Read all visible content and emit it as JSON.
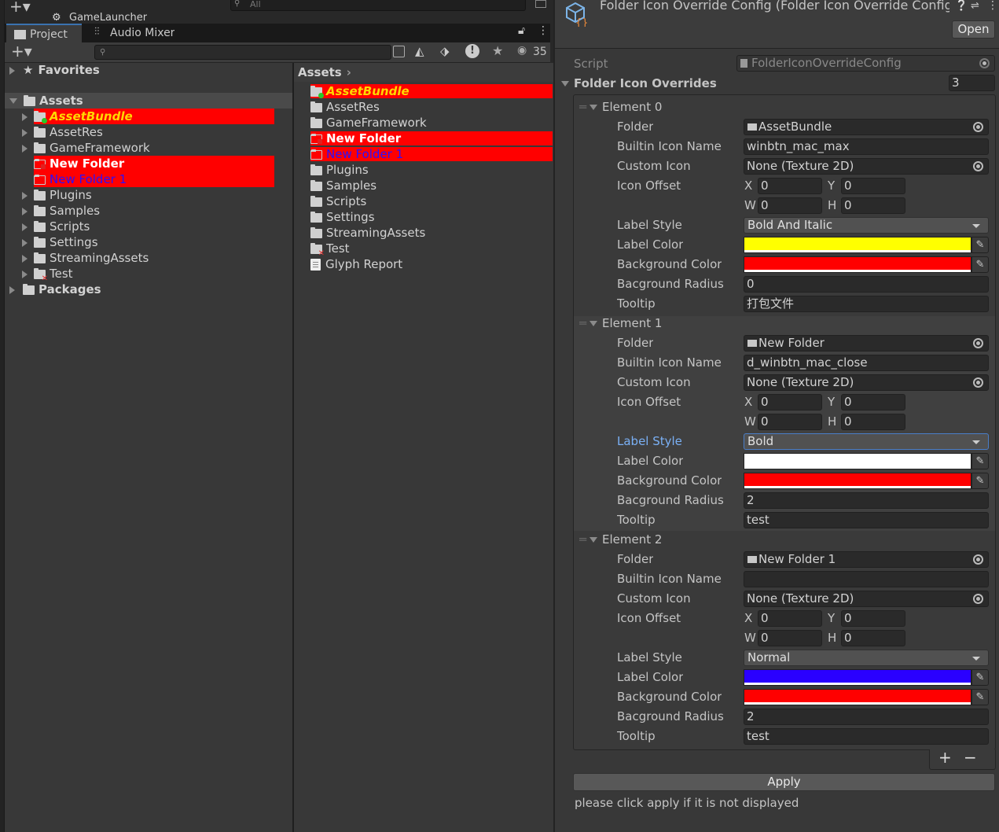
{
  "top": {
    "search_placeholder": "All",
    "launcher": "GameLauncher"
  },
  "tabs": {
    "project": "Project",
    "audio_mixer": "Audio Mixer"
  },
  "project_toolbar": {
    "search_value": "",
    "hidden_count": "35"
  },
  "tree": {
    "favorites": "Favorites",
    "assets": "Assets",
    "items": [
      {
        "label": "AssetBundle",
        "style": "yellow-italic-red"
      },
      {
        "label": "AssetRes",
        "style": "normal"
      },
      {
        "label": "GameFramework",
        "style": "normal"
      },
      {
        "label": "New Folder",
        "style": "white-bold-red"
      },
      {
        "label": "New Folder 1",
        "style": "blue-red"
      },
      {
        "label": "Plugins",
        "style": "normal"
      },
      {
        "label": "Samples",
        "style": "normal"
      },
      {
        "label": "Scripts",
        "style": "normal"
      },
      {
        "label": "Settings",
        "style": "normal"
      },
      {
        "label": "StreamingAssets",
        "style": "normal"
      },
      {
        "label": "Test",
        "style": "normal"
      }
    ],
    "packages": "Packages"
  },
  "grid": {
    "breadcrumb": "Assets",
    "items": [
      "AssetBundle",
      "AssetRes",
      "GameFramework",
      "New Folder",
      "New Folder 1",
      "Plugins",
      "Samples",
      "Scripts",
      "Settings",
      "StreamingAssets",
      "Test",
      "Glyph Report"
    ]
  },
  "inspector": {
    "title": "Folder Icon Override Config (Folder Icon Override Config",
    "open_button": "Open",
    "script_label": "Script",
    "script_value": "FolderIconOverrideConfig",
    "list_label": "Folder Icon Overrides",
    "list_size": "3",
    "labels": {
      "folder": "Folder",
      "builtin": "Builtin Icon Name",
      "custom": "Custom Icon",
      "offset": "Icon Offset",
      "x": "X",
      "y": "Y",
      "w": "W",
      "h": "H",
      "label_style": "Label Style",
      "label_color": "Label Color",
      "bg_color": "Background Color",
      "bg_radius": "Bacground Radius",
      "tooltip": "Tooltip"
    },
    "elements": [
      {
        "name": "Element 0",
        "folder": "AssetBundle",
        "builtin": "winbtn_mac_max",
        "custom": "None (Texture 2D)",
        "x": "0",
        "y": "0",
        "w": "0",
        "h": "0",
        "label_style": "Bold And Italic",
        "label_color": "#ffff00",
        "bg_color": "#ff0000",
        "radius": "0",
        "tooltip": "打包文件"
      },
      {
        "name": "Element 1",
        "folder": "New Folder",
        "builtin": "d_winbtn_mac_close",
        "custom": "None (Texture 2D)",
        "x": "0",
        "y": "0",
        "w": "0",
        "h": "0",
        "label_style": "Bold",
        "label_color": "#ffffff",
        "bg_color": "#ff0000",
        "radius": "2",
        "tooltip": "test"
      },
      {
        "name": "Element 2",
        "folder": "New Folder 1",
        "builtin": "",
        "custom": "None (Texture 2D)",
        "x": "0",
        "y": "0",
        "w": "0",
        "h": "0",
        "label_style": "Normal",
        "label_color": "#2a00ff",
        "bg_color": "#ff0000",
        "radius": "2",
        "tooltip": "test"
      }
    ],
    "add_button": "+",
    "remove_button": "−",
    "apply_button": "Apply",
    "hint": "please click apply if it is not displayed"
  },
  "colors": {
    "selection": "#3a72b0",
    "highlight_red": "#ff0000",
    "panel": "#383838"
  }
}
